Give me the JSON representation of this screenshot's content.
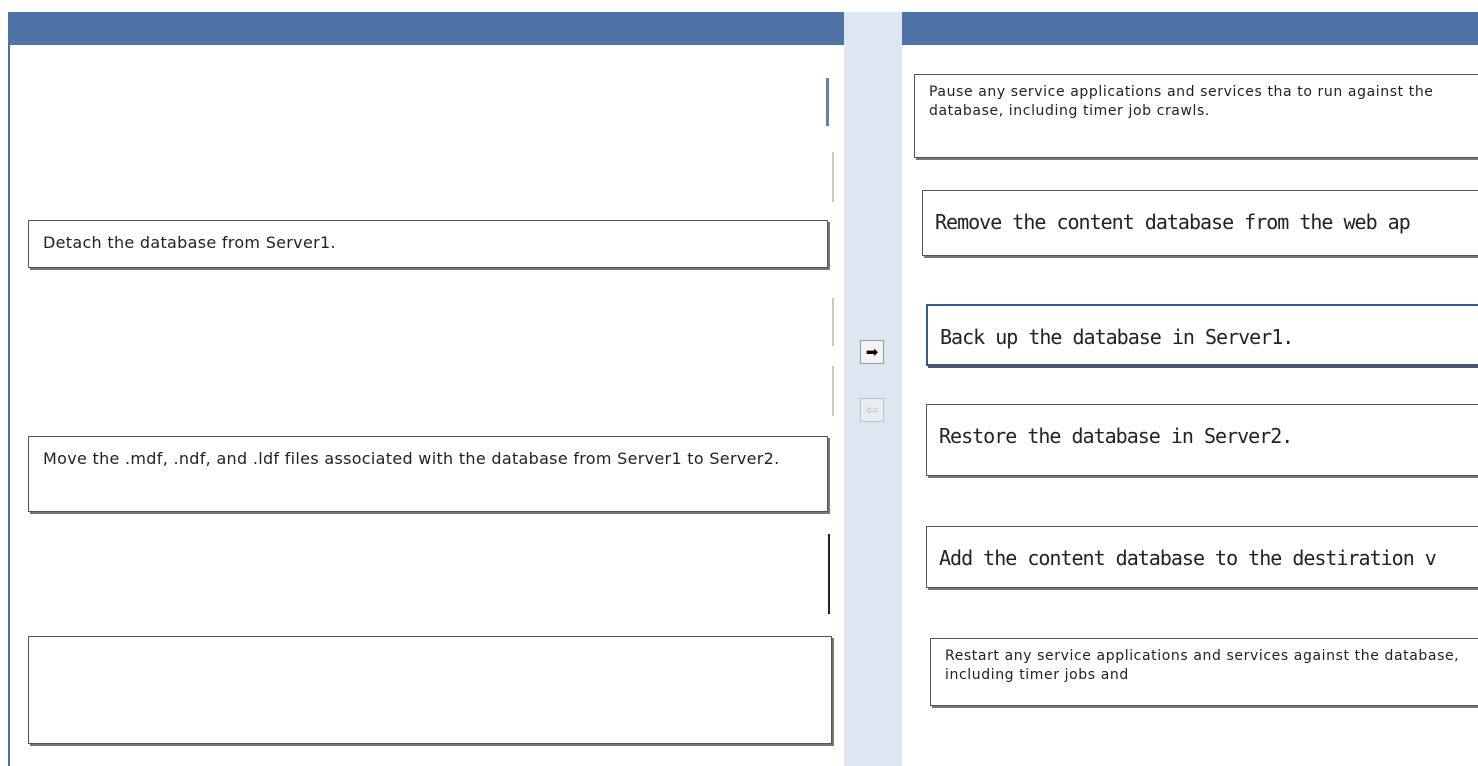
{
  "left_pane": {
    "answer_slots": [
      {
        "label": "Detach the database from Server1."
      },
      {
        "label": "Move the .mdf, .ndf, and .ldf files associated with the database from Server1 to Server2."
      },
      {
        "label": ""
      }
    ]
  },
  "controls": {
    "move_right_icon": "arrow-right-icon",
    "move_right_glyph": "➡",
    "move_left_icon": "arrow-left-icon",
    "move_left_glyph": "⇦"
  },
  "right_pane": {
    "actions": [
      {
        "label": "Pause any service applications and services tha to run against the database, including timer job crawls."
      },
      {
        "label": "Remove the content database from the web ap"
      },
      {
        "label": "Back up the database in Server1."
      },
      {
        "label": "Restore the database in Server2."
      },
      {
        "label": "Add the content database to the destiration v"
      },
      {
        "label": "Restart any service applications and services against the database, including timer jobs and"
      }
    ]
  },
  "colors": {
    "header": "#4f73a6",
    "middle_strip": "#dde7f2",
    "selected_border": "#3a5a8c"
  }
}
